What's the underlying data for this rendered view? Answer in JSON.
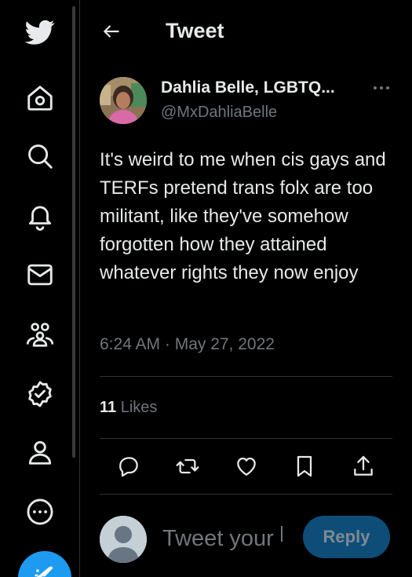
{
  "sidebar": {
    "items": [
      {
        "icon": "twitter-logo-icon"
      },
      {
        "icon": "home-icon"
      },
      {
        "icon": "search-icon"
      },
      {
        "icon": "bell-icon"
      },
      {
        "icon": "mail-icon"
      },
      {
        "icon": "communities-icon"
      },
      {
        "icon": "verified-icon"
      },
      {
        "icon": "profile-icon"
      },
      {
        "icon": "more-circle-icon"
      },
      {
        "icon": "compose-icon"
      }
    ]
  },
  "header": {
    "title": "Tweet"
  },
  "tweet": {
    "display_name": "Dahlia Belle, LGBTQ...",
    "handle": "@MxDahliaBelle",
    "text": "It's weird to me when cis gays and TERFs pretend trans folx are too militant, like they've somehow forgotten how they attained whatever rights they now enjoy",
    "timestamp": "6:24 AM · May 27, 2022",
    "likes_count": "11",
    "likes_label": "Likes"
  },
  "actions": [
    "reply-icon",
    "retweet-icon",
    "like-icon",
    "bookmark-icon",
    "share-icon"
  ],
  "reply": {
    "placeholder": "Tweet your",
    "button_label": "Reply"
  },
  "colors": {
    "background": "#000000",
    "text": "#e7e9ea",
    "secondary": "#71767b",
    "accent": "#1d9bf0",
    "divider": "#2f3336"
  }
}
